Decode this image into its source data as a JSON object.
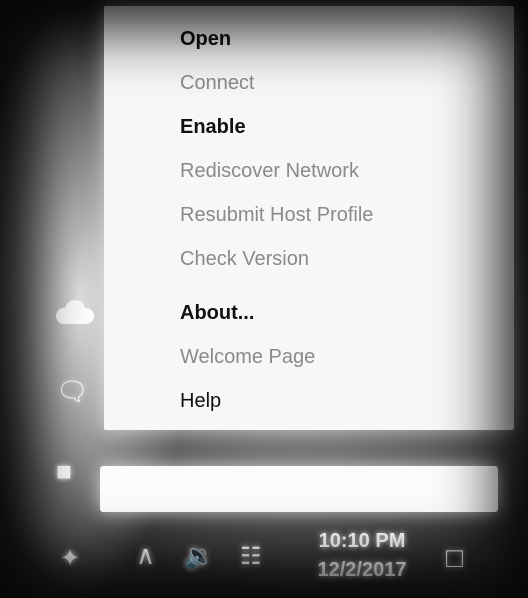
{
  "context_menu": {
    "items": [
      {
        "label": "Open",
        "style": "bold",
        "enabled": true
      },
      {
        "label": "Connect",
        "style": "normal",
        "enabled": false
      },
      {
        "label": "Enable",
        "style": "bold",
        "enabled": true
      },
      {
        "label": "Rediscover Network",
        "style": "normal",
        "enabled": false
      },
      {
        "label": "Resubmit Host Profile",
        "style": "normal",
        "enabled": false
      },
      {
        "label": "Check Version",
        "style": "normal",
        "enabled": false
      },
      {
        "label": "About...",
        "style": "bold",
        "enabled": true
      },
      {
        "label": "Welcome Page",
        "style": "normal",
        "enabled": false
      },
      {
        "label": "Help",
        "style": "normal",
        "enabled": true
      }
    ]
  },
  "taskbar": {
    "time": "10:10 PM",
    "date": "12/2/2017",
    "icons": [
      "network-app-icon",
      "chevron-up-icon",
      "volume-icon",
      "wifi-icon",
      "notification-icon"
    ]
  },
  "side_icons": [
    "cloud-icon",
    "chat-icon",
    "message-icon"
  ],
  "colors": {
    "menu_background": "#f7f7f7",
    "menu_text": "#111111",
    "menu_disabled_text": "#8a8a8a",
    "taskbar_text": "#ffffff"
  }
}
